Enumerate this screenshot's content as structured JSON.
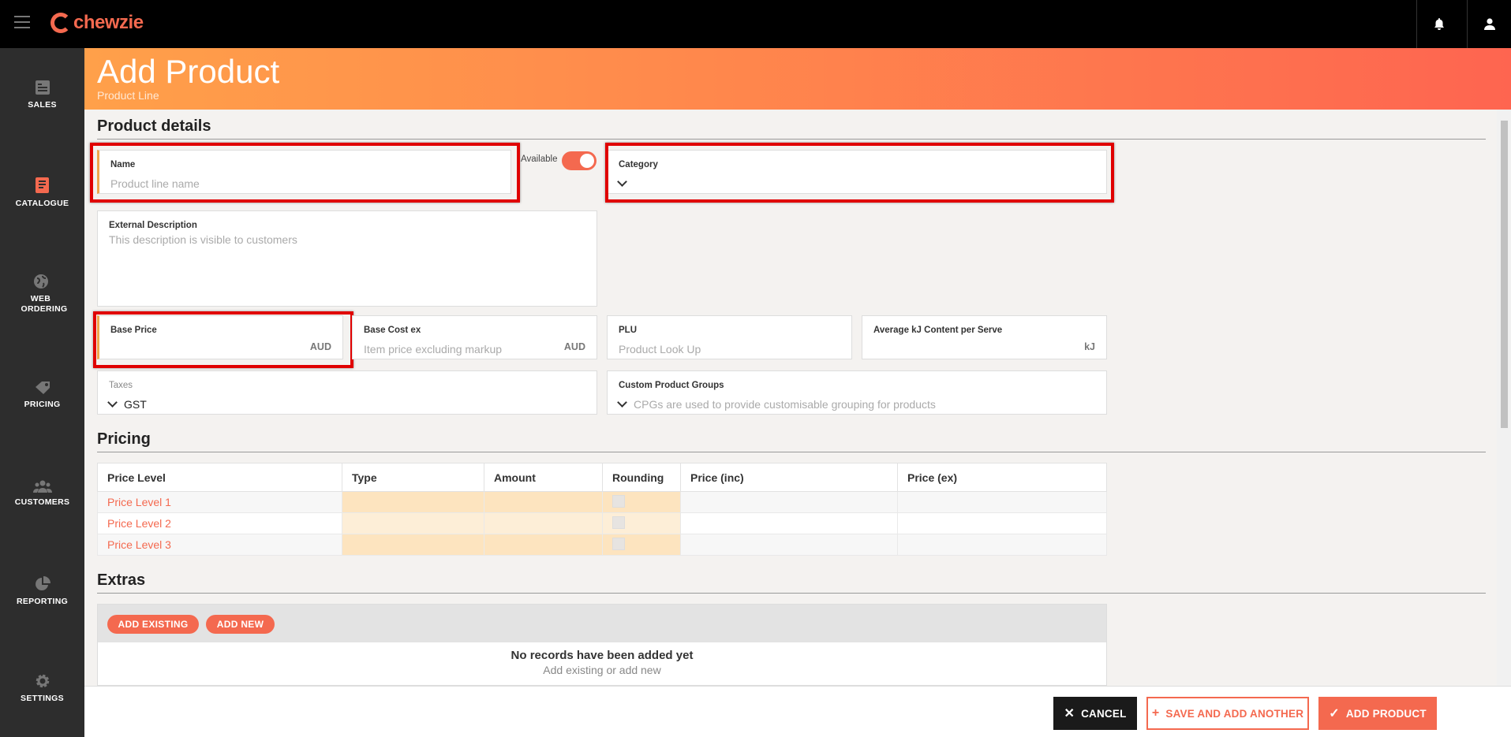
{
  "app": {
    "brand": "chewzie"
  },
  "sidebar": {
    "items": [
      {
        "label": "SALES"
      },
      {
        "label": "CATALOGUE"
      },
      {
        "label": "WEB ORDERING"
      },
      {
        "label": "PRICING"
      },
      {
        "label": "CUSTOMERS"
      },
      {
        "label": "REPORTING"
      },
      {
        "label": "SETTINGS"
      }
    ]
  },
  "header": {
    "title": "Add Product",
    "subtitle": "Product Line"
  },
  "product_details": {
    "title": "Product details",
    "name": {
      "label": "Name",
      "placeholder": "Product line name"
    },
    "available": {
      "label": "Available",
      "on": true
    },
    "category": {
      "label": "Category",
      "value": ""
    },
    "external_description": {
      "label": "External Description",
      "placeholder": "This description is visible to customers"
    },
    "base_price": {
      "label": "Base Price",
      "suffix": "AUD"
    },
    "base_cost": {
      "label": "Base Cost ex",
      "placeholder": "Item price excluding markup",
      "suffix": "AUD"
    },
    "plu": {
      "label": "PLU",
      "placeholder": "Product Look Up"
    },
    "average_kj": {
      "label": "Average kJ Content per Serve",
      "suffix": "kJ"
    },
    "taxes": {
      "label": "Taxes",
      "value": "GST"
    },
    "custom_groups": {
      "label": "Custom Product Groups",
      "placeholder": "CPGs are used to provide customisable grouping for products"
    }
  },
  "pricing": {
    "title": "Pricing",
    "columns": [
      "Price Level",
      "Type",
      "Amount",
      "Rounding",
      "Price (inc)",
      "Price (ex)"
    ],
    "rows": [
      {
        "level": "Price Level 1"
      },
      {
        "level": "Price Level 2"
      },
      {
        "level": "Price Level 3"
      }
    ]
  },
  "extras": {
    "title": "Extras",
    "add_existing": "ADD EXISTING",
    "add_new": "ADD NEW",
    "empty_title": "No records have been added yet",
    "empty_sub": "Add existing or add new"
  },
  "footer": {
    "cancel": "CANCEL",
    "save_another": "SAVE AND ADD ANOTHER",
    "add_product": "ADD PRODUCT"
  },
  "colors": {
    "accent": "#f4694f",
    "required": "#f0a64a",
    "highlight": "#e00000"
  }
}
